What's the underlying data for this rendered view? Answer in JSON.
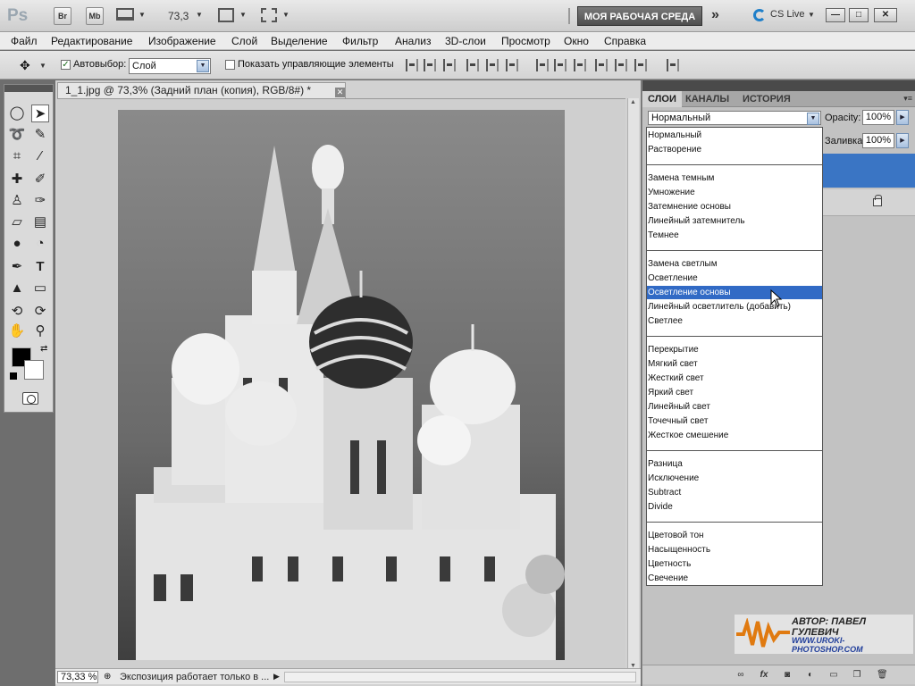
{
  "appbar": {
    "logo": "Ps",
    "bridge": "Br",
    "minibridge": "Mb",
    "zoom": "73,3",
    "workspace": "МОЯ РАБОЧАЯ СРЕДА",
    "cslive": "CS Live"
  },
  "menu": [
    "Файл",
    "Редактирование",
    "Изображение",
    "Слой",
    "Выделение",
    "Фильтр",
    "Анализ",
    "3D-слои",
    "Просмотр",
    "Окно",
    "Справка"
  ],
  "options": {
    "autoselect_label": "Автовыбор:",
    "autoselect_value": "Слой",
    "show_controls_label": "Показать управляющие элементы"
  },
  "document": {
    "tab_title": "1_1.jpg @ 73,3% (Задний план (копия), RGB/8#) *",
    "zoom": "73,33 %",
    "status": "Экспозиция работает только в ..."
  },
  "panel": {
    "tabs": [
      "СЛОИ",
      "КАНАЛЫ",
      "ИСТОРИЯ"
    ],
    "blend_mode": "Нормальный",
    "opacity_label": "Opacity:",
    "opacity_value": "100%",
    "fill_label": "Заливка:",
    "fill_value": "100%"
  },
  "blend_list": {
    "groups": [
      [
        "Нормальный",
        "Растворение"
      ],
      [
        "Замена темным",
        "Умножение",
        "Затемнение основы",
        "Линейный затемнитель",
        "Темнее"
      ],
      [
        "Замена светлым",
        "Осветление",
        "Осветление основы",
        "Линейный осветлитель (добавить)",
        "Светлее"
      ],
      [
        "Перекрытие",
        "Мягкий свет",
        "Жесткий свет",
        "Яркий свет",
        "Линейный свет",
        "Точечный свет",
        "Жесткое смешение"
      ],
      [
        "Разница",
        "Исключение",
        "Subtract",
        "Divide"
      ],
      [
        "Цветовой тон",
        "Насыщенность",
        "Цветность",
        "Свечение"
      ]
    ],
    "highlighted": "Осветление основы"
  },
  "watermark": {
    "author": "АВТОР: ПАВЕЛ ГУЛЕВИЧ",
    "site": "WWW.UROKI-PHOTOSHOP.COM"
  },
  "colors": {
    "accent": "#316ac5",
    "layer_selected": "#3a75c4",
    "cslive": "#1f7fc9"
  }
}
